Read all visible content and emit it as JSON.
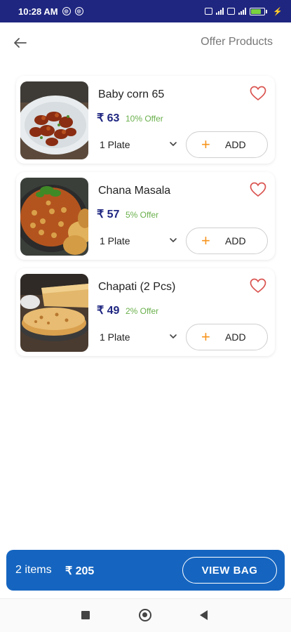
{
  "status_bar": {
    "time": "10:28 AM",
    "battery": "64"
  },
  "header": {
    "title": "Offer Products",
    "back_icon": "arrow-left-icon"
  },
  "products": [
    {
      "name": "Baby corn 65",
      "price": "₹ 63",
      "offer": "10% Offer",
      "qty": "1 Plate",
      "add_label": "ADD",
      "add_symbol": "+"
    },
    {
      "name": "Chana Masala",
      "price": "₹ 57",
      "offer": "5% Offer",
      "qty": "1 Plate",
      "add_label": "ADD",
      "add_symbol": "+"
    },
    {
      "name": "Chapati (2 Pcs)",
      "price": "₹ 49",
      "offer": "2% Offer",
      "qty": "1 Plate",
      "add_label": "ADD",
      "add_symbol": "+"
    }
  ],
  "bag": {
    "items": "2 items",
    "total": "₹ 205",
    "button_label": "VIEW BAG"
  },
  "colors": {
    "status_bar": "#1f2680",
    "price": "#1f2680",
    "offer": "#6ab04c",
    "add_plus": "#f7941d",
    "heart": "#d9534f",
    "bag_bar": "#1565c0"
  }
}
